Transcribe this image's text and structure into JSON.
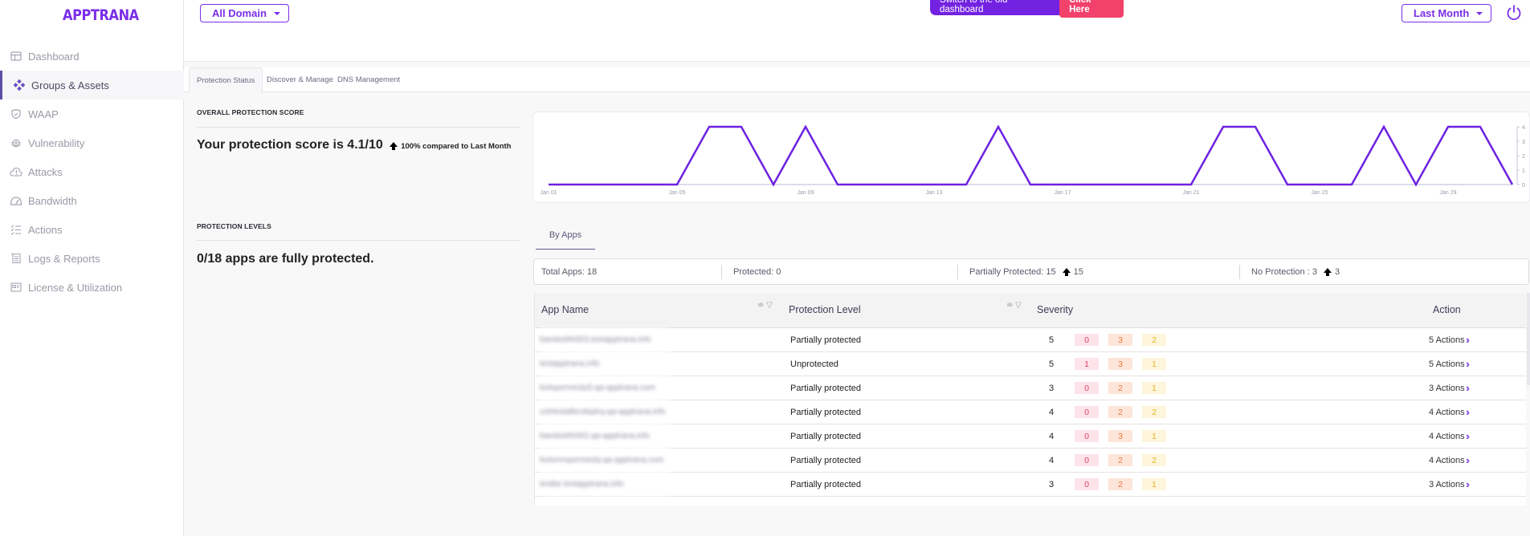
{
  "app": {
    "logo": "APPTRANA"
  },
  "sidebar": {
    "items": [
      {
        "label": "Dashboard",
        "icon": "dashboard-icon"
      },
      {
        "label": "Groups & Assets",
        "icon": "groups-icon",
        "active": true
      },
      {
        "label": "WAAP",
        "icon": "shield-icon"
      },
      {
        "label": "Vulnerability",
        "icon": "bug-icon"
      },
      {
        "label": "Attacks",
        "icon": "cloud-alert-icon"
      },
      {
        "label": "Bandwidth",
        "icon": "gauge-icon"
      },
      {
        "label": "Actions",
        "icon": "checklist-icon"
      },
      {
        "label": "Logs & Reports",
        "icon": "logs-icon"
      },
      {
        "label": "License & Utilization",
        "icon": "license-icon"
      }
    ]
  },
  "header": {
    "domain_select": "All Domain",
    "banner_text": "Switch to the old dashboard",
    "banner_button": "Click Here",
    "period_select": "Last Month",
    "colors": {
      "accent": "#7a2ee8",
      "banner": "#7322e2",
      "banner_button": "#f2416a"
    }
  },
  "tabs": [
    {
      "label": "Protection Status",
      "active": true
    },
    {
      "label": "Discover & Manage"
    },
    {
      "label": "DNS Management"
    }
  ],
  "score": {
    "section_label": "OVERALL PROTECTION SCORE",
    "text": "Your protection score is 4.1/10",
    "change": "100% compared to Last Month"
  },
  "levels": {
    "section_label": "PROTECTION LEVELS",
    "text": "0/18 apps are fully protected."
  },
  "chart_data": {
    "type": "line",
    "title": "",
    "xlabel": "",
    "ylabel": "",
    "x": [
      "Jan 01",
      "Jan 02",
      "Jan 03",
      "Jan 04",
      "Jan 05",
      "Jan 06",
      "Jan 07",
      "Jan 08",
      "Jan 09",
      "Jan 10",
      "Jan 11",
      "Jan 12",
      "Jan 13",
      "Jan 14",
      "Jan 15",
      "Jan 16",
      "Jan 17",
      "Jan 18",
      "Jan 19",
      "Jan 20",
      "Jan 21",
      "Jan 22",
      "Jan 23",
      "Jan 24",
      "Jan 25",
      "Jan 26",
      "Jan 27",
      "Jan 28",
      "Jan 29",
      "Jan 30",
      "Jan 31"
    ],
    "series": [
      {
        "name": "score",
        "color": "#6d22e0",
        "values": [
          0,
          0,
          0,
          0,
          0,
          4,
          4,
          0,
          4,
          0,
          0,
          0,
          0,
          0,
          4,
          0,
          0,
          0,
          0,
          0,
          0,
          4,
          4,
          0,
          0,
          0,
          4,
          0,
          4,
          4,
          0
        ]
      }
    ],
    "x_tick_labels": [
      "Jan 01",
      "Jan 05",
      "Jan 09",
      "Jan 13",
      "Jan 17",
      "Jan 21",
      "Jan 25",
      "Jan 29"
    ],
    "y_tick_labels": [
      "0",
      "1",
      "2",
      "3",
      "4"
    ],
    "ylim": [
      0,
      4
    ],
    "y_axis_side": "right",
    "grid": false,
    "legend": "none"
  },
  "by_apps": {
    "tab_label": "By Apps",
    "summary": {
      "total": "Total Apps: 18",
      "protected": "Protected: 0",
      "partial": "Partially Protected: 15",
      "partial_change": "15",
      "none": "No Protection : 3",
      "none_change": "3"
    },
    "columns": [
      "App Name",
      "Protection Level",
      "Severity",
      "Action"
    ],
    "rows": [
      {
        "app": "banded4h003.testapptrana.info",
        "level": "Partially protected",
        "severity": "5",
        "critical": "0",
        "high": "3",
        "medium": "2",
        "action": "5 Actions"
      },
      {
        "app": "testapptrana.info",
        "level": "Unprotected",
        "severity": "5",
        "critical": "1",
        "high": "3",
        "medium": "1",
        "action": "5 Actions"
      },
      {
        "app": "botspermesty5.qa-apptrana.com",
        "level": "Partially protected",
        "severity": "3",
        "critical": "0",
        "high": "2",
        "medium": "1",
        "action": "3 Actions"
      },
      {
        "app": "cohtestafterdeploy.qa-apptrana.info",
        "level": "Partially protected",
        "severity": "4",
        "critical": "0",
        "high": "2",
        "medium": "2",
        "action": "4 Actions"
      },
      {
        "app": "banded4h002.qa-apptrana.info",
        "level": "Partially protected",
        "severity": "4",
        "critical": "0",
        "high": "3",
        "medium": "1",
        "action": "4 Actions"
      },
      {
        "app": "botsmrspermesty.qa-apptrana.com",
        "level": "Partially protected",
        "severity": "4",
        "critical": "0",
        "high": "2",
        "medium": "2",
        "action": "4 Actions"
      },
      {
        "app": "testbe.testapptrana.info",
        "level": "Partially protected",
        "severity": "3",
        "critical": "0",
        "high": "2",
        "medium": "1",
        "action": "3 Actions"
      }
    ]
  }
}
